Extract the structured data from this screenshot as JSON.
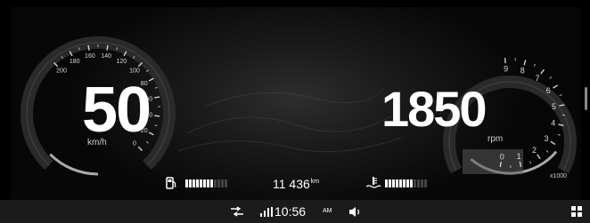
{
  "speedometer": {
    "value": "50",
    "unit": "km/h",
    "ticks": [
      "0",
      "20",
      "40",
      "60",
      "80",
      "100",
      "120",
      "140",
      "160",
      "180",
      "200"
    ]
  },
  "tachometer": {
    "value": "1850",
    "unit": "rpm",
    "ticks": [
      "0",
      "1",
      "2",
      "3",
      "4",
      "5",
      "6",
      "7",
      "8",
      "9"
    ],
    "multiplier": "x1000"
  },
  "fuel": {
    "icon": "fuel-pump-icon",
    "level": 0.7
  },
  "coolant": {
    "icon": "coolant-temperature-icon",
    "level": 0.7
  },
  "odometer": {
    "value": "11 436",
    "unit": "km"
  },
  "status_bar": {
    "time": "10:56",
    "ampm": "AM",
    "icons": [
      "drive-mode-icon",
      "signal-icon",
      "volume-icon",
      "grid-menu-icon"
    ]
  },
  "colors": {
    "accent": "#ffffff",
    "inactive": "#444444",
    "background": "#141414",
    "status_bar": "#1b1b1b"
  }
}
